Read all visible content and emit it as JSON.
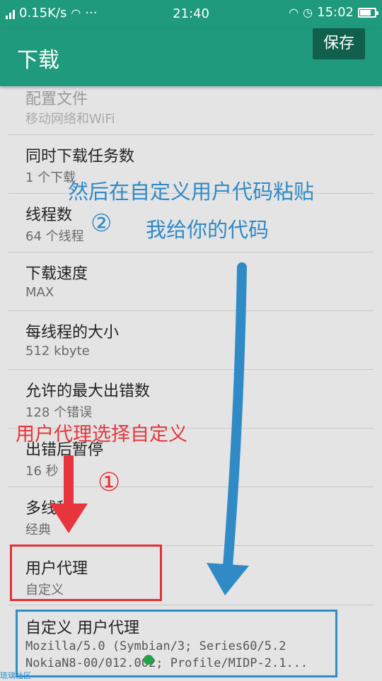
{
  "status_bar": {
    "left_prefix": ".il",
    "speed": "0.15K/s",
    "time": "21:40",
    "right_text": "15:02"
  },
  "toolbar": {
    "title": "下载",
    "save_label": "保存"
  },
  "settings": [
    {
      "title": "配置文件",
      "subtitle": "移动网络和WiFi"
    },
    {
      "title": "同时下载任务数",
      "subtitle": "1 个下载"
    },
    {
      "title": "线程数",
      "subtitle": "64 个线程"
    },
    {
      "title": "下载速度",
      "subtitle": "MAX"
    },
    {
      "title": "每线程的大小",
      "subtitle": "512 kbyte"
    },
    {
      "title": "允许的最大出错数",
      "subtitle": "128 个错误"
    },
    {
      "title": "出错后暂停",
      "subtitle": "16 秒"
    },
    {
      "title": "多线程",
      "subtitle": "经典"
    },
    {
      "title": "用户代理",
      "subtitle": "自定义"
    }
  ],
  "custom_agent": {
    "title": "自定义 用户代理",
    "line1": "Mozilla/5.0 (Symbian/3; Series60/5.2",
    "line2": "NokiaN8-00/012.002; Profile/MIDP-2.1..."
  },
  "annotations": {
    "step2_line1": "然后在自定义用户代码粘贴",
    "step2_num": "②",
    "step2_line2": "我给你的代码",
    "step1_text": "用户代理选择自定义",
    "step1_num": "①",
    "red": "#e6353d",
    "blue": "#2f8ac6"
  },
  "theme": {
    "primary": "#1f9a7c",
    "primary_dark": "#10604d"
  },
  "watermark": "琉璃社区"
}
